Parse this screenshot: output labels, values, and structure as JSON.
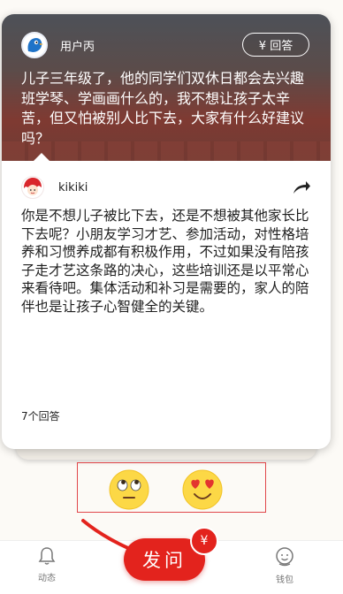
{
  "question": {
    "asker_name": "用户丙",
    "answer_button": "¥ 回答",
    "text": "儿子三年级了，他的同学们双休日都会去兴趣班学琴、学画画什么的，我不想让孩子太辛苦，但又怕被别人比下去，大家有什么好建议吗？"
  },
  "answer": {
    "answerer_name": "kikiki",
    "text": "你是不想儿子被比下去，还是不想被其他家长比下去呢？小朋友学习才艺、参加活动，对性格培养和习惯养成都有积极作用，不过如果没有陪孩子走才艺这条路的决心，这些培训还是以平常心来看待吧。集体活动和补习是需要的，家人的陪伴也是让孩子心智健全的关键。",
    "count": "7个回答"
  },
  "reactions": [
    "eye-roll-emoji",
    "heart-eyes-emoji"
  ],
  "nav": {
    "left_label": "动态",
    "ask_label": "发问",
    "badge": "¥",
    "right_label": "钱包"
  },
  "colors": {
    "accent": "#e3231d",
    "highlight_border": "#e0474b"
  }
}
